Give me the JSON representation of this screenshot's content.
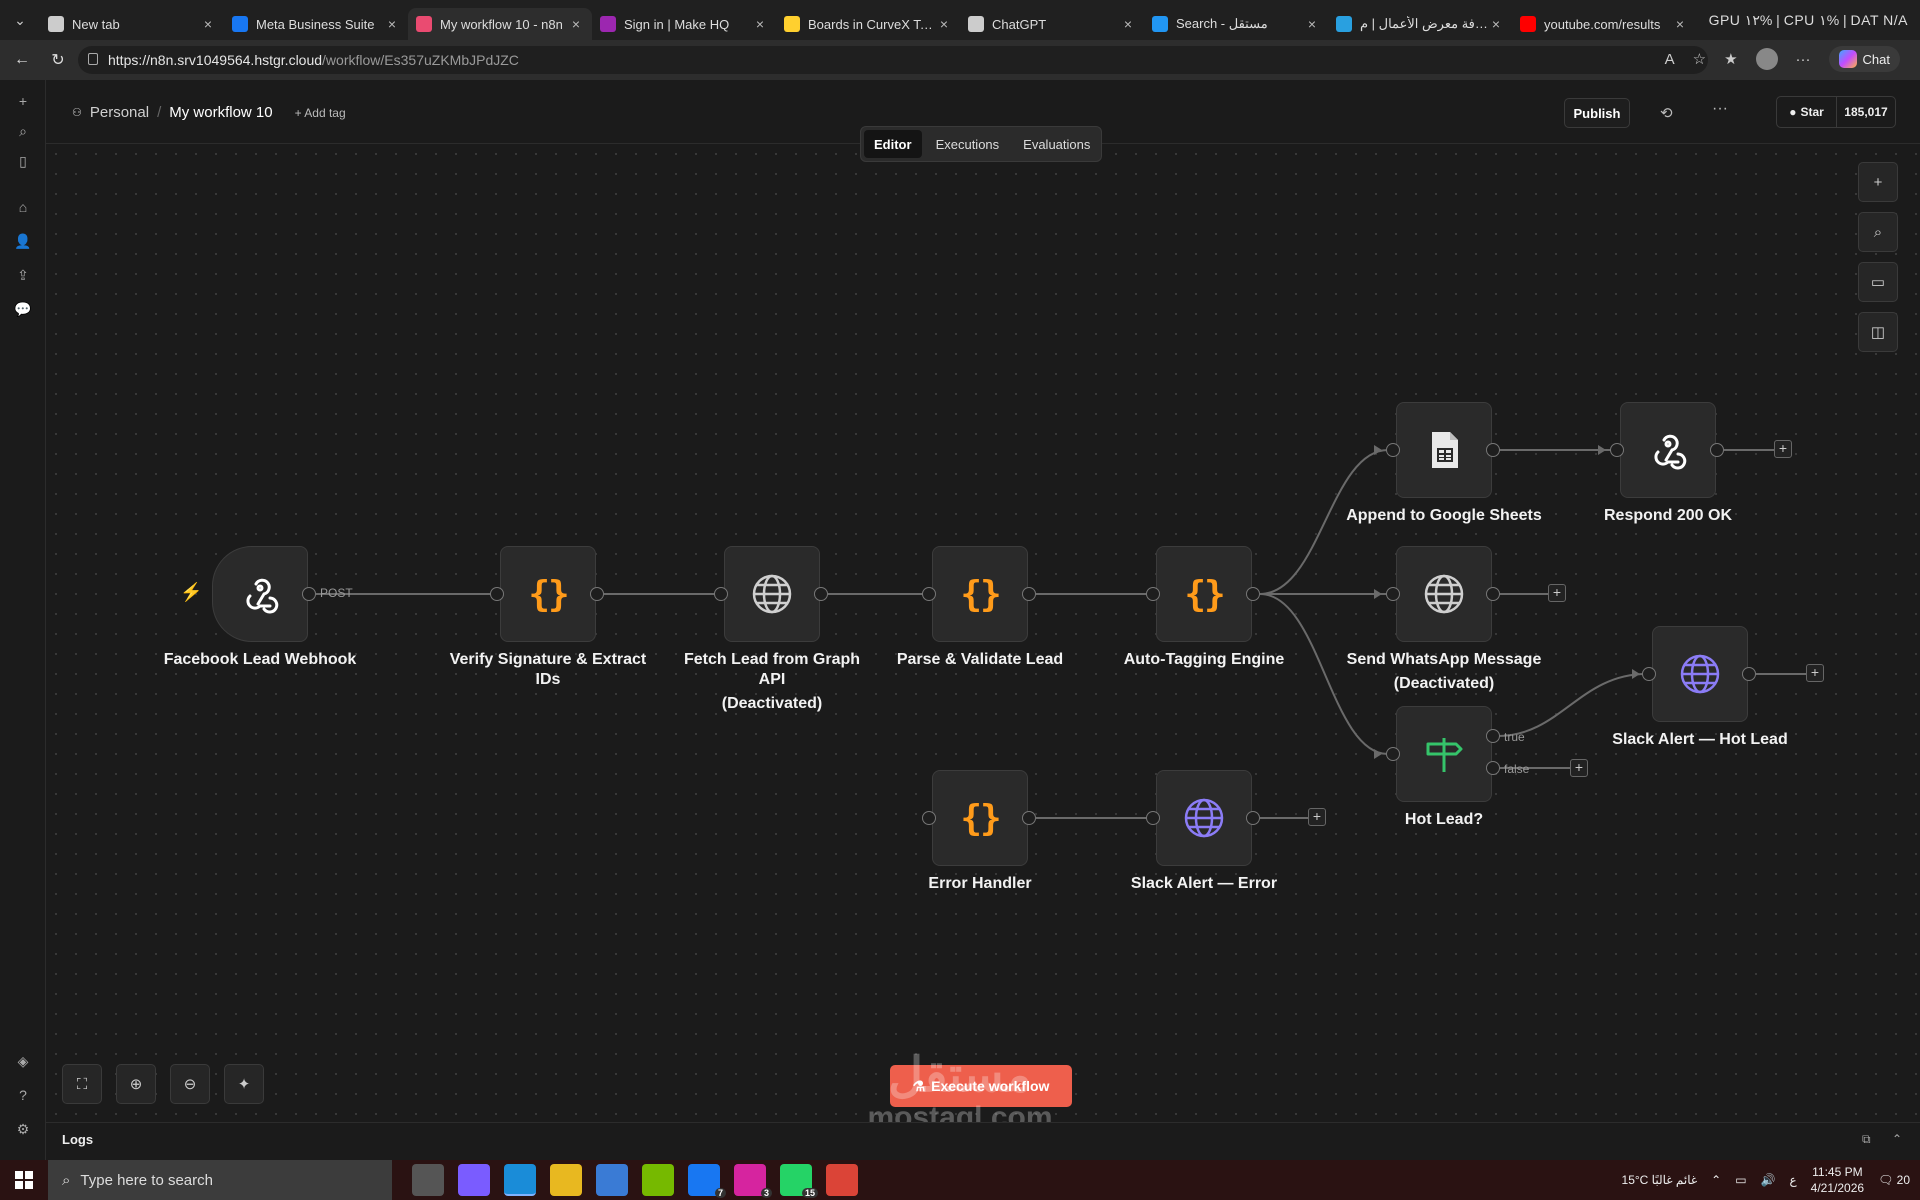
{
  "browser": {
    "tabs": [
      {
        "label": "New tab",
        "icon": "newtab-icon",
        "color": "#cccccc",
        "active": false
      },
      {
        "label": "Meta Business Suite",
        "icon": "meta-icon",
        "color": "#1877f2",
        "active": false
      },
      {
        "label": "My workflow 10 - n8n",
        "icon": "n8n-icon",
        "color": "#ea4b71",
        "active": true
      },
      {
        "label": "Sign in | Make HQ",
        "icon": "make-icon",
        "color": "#9c27b0",
        "active": false
      },
      {
        "label": "Boards in CurveX Team",
        "icon": "miro-icon",
        "color": "#ffd02f",
        "active": false
      },
      {
        "label": "ChatGPT",
        "icon": "openai-icon",
        "color": "#cccccc",
        "active": false
      },
      {
        "label": "Search - مستقل",
        "icon": "search-icon",
        "color": "#2196f3",
        "active": false
      },
      {
        "label": "إضافة معرض الأعمال | م",
        "icon": "mostaql-icon",
        "color": "#29a0e0",
        "active": false
      },
      {
        "label": "youtube.com/results",
        "icon": "youtube-icon",
        "color": "#ff0000",
        "active": false
      }
    ],
    "perf": "GPU  ١٢%  |  CPU  ١%  |  DAT  N/A",
    "url_host": "https://n8n.srv1049564.hstgr.cloud",
    "url_path": "/workflow/Es357uZKMbJPdJZC",
    "chat_label": "Chat"
  },
  "header": {
    "project": "Personal",
    "workflow_name": "My workflow 10",
    "add_tag": "+ Add tag",
    "publish": "Publish",
    "github_star": "Star",
    "github_count": "185,017"
  },
  "view_tabs": [
    {
      "label": "Editor",
      "active": true
    },
    {
      "label": "Executions",
      "active": false
    },
    {
      "label": "Evaluations",
      "active": false
    }
  ],
  "nodes": {
    "webhook": {
      "label": "Facebook Lead Webhook",
      "icon": "webhook-icon",
      "output_label": "POST"
    },
    "verify": {
      "label": "Verify Signature & Extract IDs",
      "icon": "code-braces-icon"
    },
    "fetch": {
      "label": "Fetch Lead from Graph API",
      "sub": "(Deactivated)",
      "icon": "globe-icon"
    },
    "parse": {
      "label": "Parse & Validate Lead",
      "icon": "code-braces-icon"
    },
    "autotag": {
      "label": "Auto-Tagging Engine",
      "icon": "code-braces-icon"
    },
    "sheets": {
      "label": "Append to Google Sheets",
      "icon": "google-sheets-icon"
    },
    "respond": {
      "label": "Respond 200 OK",
      "icon": "webhook-icon"
    },
    "whatsapp": {
      "label": "Send WhatsApp Message",
      "sub": "(Deactivated)",
      "icon": "globe-icon"
    },
    "hotlead": {
      "label": "Hot Lead?",
      "icon": "signpost-icon",
      "true_label": "true",
      "false_label": "false"
    },
    "slack_hot": {
      "label": "Slack Alert — Hot Lead",
      "icon": "globe-icon"
    },
    "error_handler": {
      "label": "Error Handler",
      "icon": "code-braces-icon"
    },
    "slack_error": {
      "label": "Slack Alert — Error",
      "icon": "globe-icon"
    }
  },
  "execute_button": "Execute workflow",
  "logs_label": "Logs",
  "watermark": {
    "arabic": "مستقل",
    "latin": "mostaql.com"
  },
  "taskbar": {
    "search_placeholder": "Type here to search",
    "weather": "15°C  غائم غالبًا",
    "lang": "ع",
    "time": "11:45 PM",
    "date": "4/21/2026",
    "notifications": "20",
    "apps": [
      {
        "name": "task-view-icon",
        "badge": ""
      },
      {
        "name": "copilot-icon",
        "badge": ""
      },
      {
        "name": "edge-icon",
        "badge": ""
      },
      {
        "name": "file-explorer-icon",
        "badge": ""
      },
      {
        "name": "store-icon",
        "badge": ""
      },
      {
        "name": "nvidia-icon",
        "badge": ""
      },
      {
        "name": "facebook-icon",
        "badge": "7"
      },
      {
        "name": "instagram-icon",
        "badge": "3"
      },
      {
        "name": "whatsapp-icon",
        "badge": "15"
      },
      {
        "name": "chrome-icon",
        "badge": ""
      }
    ]
  },
  "colors": {
    "accent": "#ee5f4c",
    "code_icon": "#ff9b1a",
    "http_icon": "#8b7cf6",
    "if_icon": "#35c46a",
    "trigger_bolt": "#ff5c5c"
  }
}
